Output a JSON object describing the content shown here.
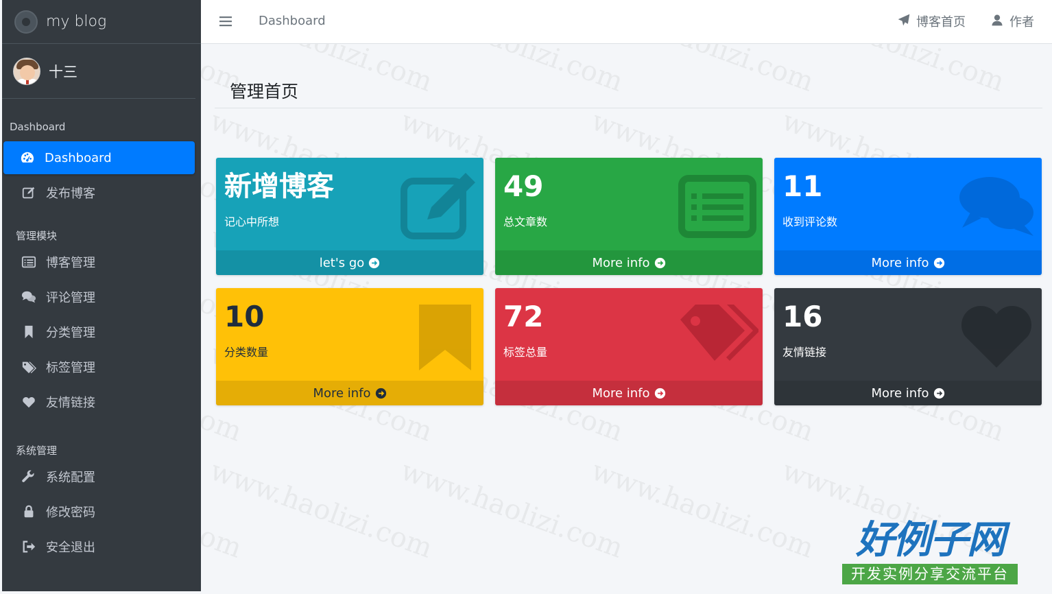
{
  "brand": {
    "name": "my blog"
  },
  "user": {
    "name": "十三"
  },
  "sidebar": {
    "header_dashboard": "Dashboard",
    "dashboard": "Dashboard",
    "publish": "发布博客",
    "header_manage": "管理模块",
    "blog_manage": "博客管理",
    "comment_manage": "评论管理",
    "category_manage": "分类管理",
    "tag_manage": "标签管理",
    "links": "友情链接",
    "header_system": "系统管理",
    "system_config": "系统配置",
    "change_password": "修改密码",
    "logout": "安全退出"
  },
  "topbar": {
    "breadcrumb": "Dashboard",
    "blog_home": "博客首页",
    "author": "作者"
  },
  "page": {
    "title": "管理首页"
  },
  "boxes": [
    {
      "number": "新增博客",
      "label": "记心中所想",
      "footer": "let's go",
      "color": "#17a2b8",
      "icon": "edit-icon"
    },
    {
      "number": "49",
      "label": "总文章数",
      "footer": "More info",
      "color": "#28a745",
      "icon": "list-icon"
    },
    {
      "number": "11",
      "label": "收到评论数",
      "footer": "More info",
      "color": "#007bff",
      "icon": "comments-icon"
    },
    {
      "number": "10",
      "label": "分类数量",
      "footer": "More info",
      "color": "#ffc107",
      "icon": "bookmark-icon"
    },
    {
      "number": "72",
      "label": "标签总量",
      "footer": "More info",
      "color": "#dc3545",
      "icon": "tags-icon"
    },
    {
      "number": "16",
      "label": "友情链接",
      "footer": "More info",
      "color": "#343a40",
      "icon": "heart-icon"
    }
  ],
  "watermark": {
    "text": "www.haolizi.com"
  },
  "site_logo": {
    "title": "好例子网",
    "subtitle": "开发实例分享交流平台"
  }
}
